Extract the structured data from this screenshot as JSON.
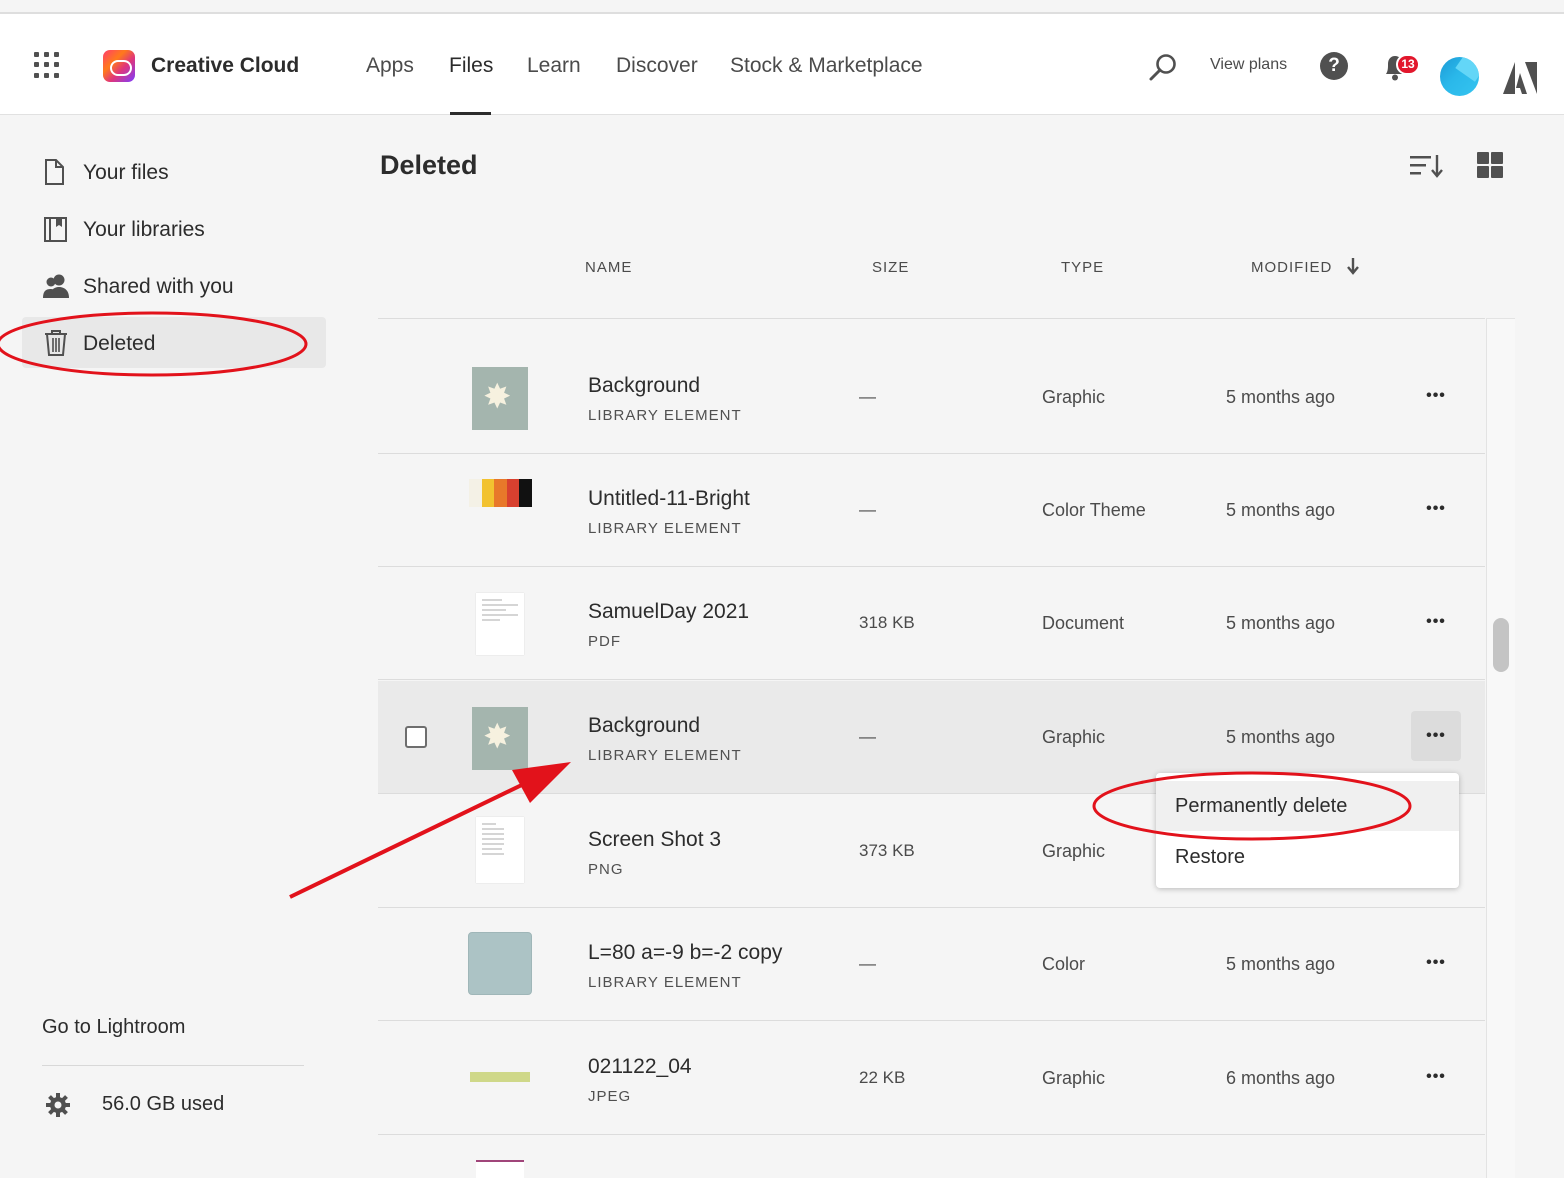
{
  "header": {
    "brand": "Creative Cloud",
    "nav": [
      "Apps",
      "Files",
      "Learn",
      "Discover",
      "Stock & Marketplace"
    ],
    "active_nav": "Files",
    "view_plans": "View plans",
    "notification_count": "13"
  },
  "sidebar": {
    "items": [
      {
        "label": "Your files",
        "icon": "file-icon"
      },
      {
        "label": "Your libraries",
        "icon": "libraries-icon"
      },
      {
        "label": "Shared with you",
        "icon": "people-icon"
      },
      {
        "label": "Deleted",
        "icon": "trash-icon",
        "selected": true
      }
    ],
    "lightroom": "Go to Lightroom",
    "storage": "56.0 GB used"
  },
  "main": {
    "title": "Deleted",
    "columns": {
      "name": "NAME",
      "size": "SIZE",
      "type": "TYPE",
      "modified": "MODIFIED"
    },
    "rows": [
      {
        "name": "Background",
        "kind": "LIBRARY ELEMENT",
        "size": "—",
        "type": "Graphic",
        "modified": "5 months ago",
        "thumb": "graphic"
      },
      {
        "name": "Untitled-11-Bright",
        "kind": "LIBRARY ELEMENT",
        "size": "—",
        "type": "Color Theme",
        "modified": "5 months ago",
        "thumb": "theme"
      },
      {
        "name": "SamuelDay 2021",
        "kind": "PDF",
        "size": "318 KB",
        "type": "Document",
        "modified": "5 months ago",
        "thumb": "doc"
      },
      {
        "name": "Background",
        "kind": "LIBRARY ELEMENT",
        "size": "—",
        "type": "Graphic",
        "modified": "5 months ago",
        "thumb": "graphic",
        "hover": true
      },
      {
        "name": "Screen Shot 3",
        "kind": "PNG",
        "size": "373 KB",
        "type": "Graphic",
        "modified": "",
        "thumb": "doc"
      },
      {
        "name": "L=80 a=-9 b=-2 copy",
        "kind": "LIBRARY ELEMENT",
        "size": "—",
        "type": "Color",
        "modified": "5 months ago",
        "thumb": "color"
      },
      {
        "name": "021122_04",
        "kind": "JPEG",
        "size": "22 KB",
        "type": "Graphic",
        "modified": "6 months ago",
        "thumb": "strip"
      }
    ],
    "more_label": "•••",
    "menu": {
      "permanently_delete": "Permanently delete",
      "restore": "Restore"
    }
  },
  "colors": {
    "annotation_red": "#e2121b",
    "theme_swatches": [
      "#f4f1e6",
      "#f2c230",
      "#e8782a",
      "#d8402f",
      "#111111"
    ]
  }
}
